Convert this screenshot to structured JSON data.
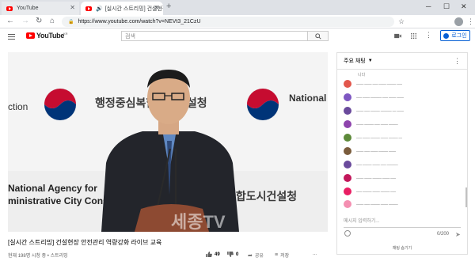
{
  "browser": {
    "tabs": [
      {
        "title": "YouTube",
        "active": false
      },
      {
        "title": "[실시간 스트리밍] 건설현장",
        "active": true
      }
    ],
    "url": "https://www.youtube.com/watch?v=NEVt3_21CzU",
    "new_tab_symbol": "+",
    "window_controls": [
      "─",
      "☐",
      "✕"
    ],
    "icons": [
      "back-icon",
      "forward-icon",
      "reload-icon",
      "home-icon",
      "lock-icon",
      "star-icon",
      "profile-icon",
      "menu-icon"
    ]
  },
  "youtube": {
    "logo_text": "YouTube",
    "logo_suffix": "KR",
    "search_placeholder": "검색",
    "login_label": "로그인",
    "colors": {
      "brand": "#ff0000",
      "link": "#065fd4"
    }
  },
  "video": {
    "title": "[실시간 스트리밍] 건설현장 안전관리 역량강화 라이브 교육",
    "meta": "현재 198명 시청 중 • 스트리밍",
    "likes": "49",
    "dislikes": "0",
    "share_label": "공유",
    "save_label": "저장",
    "more_label": "...",
    "frame": {
      "backdrop_center": "행정중심복합도시건설청",
      "backdrop_right": "National Administ",
      "backdrop_left": "ction",
      "backdrop_bottom_en_1": "National Agency for",
      "backdrop_bottom_en_2": "ministrative City Const",
      "backdrop_bottom_kr": "복합도시건설청",
      "watermark": "세종TV"
    }
  },
  "chat": {
    "title": "주요 채팅",
    "first_line": "니다",
    "messages": [
      {
        "avatar_color": "#e2574c",
        "text": "━━━━ ━━━━ ━━━ ━━━━ ━━━━━ ━━━"
      },
      {
        "avatar_color": "#7e57c2",
        "text": "━━━ ━━━━ ━━━━━━ ━━━ ━━━━ ━━━━"
      },
      {
        "avatar_color": "#6a4a9c",
        "text": "━━━━ ━━━ ━━━━━ ━━━━━━ ━━ ━━━━"
      },
      {
        "avatar_color": "#8e44ad",
        "text": "━━━━ ━━━━━ ━━━ ━━━━ ━━━━━"
      },
      {
        "avatar_color": "#5d8a3a",
        "text": "━━━ ━━━━ ━━━━━ ━━━━ ━━━━━ ━━"
      },
      {
        "avatar_color": "#7a5c3c",
        "text": "━━━━ ━━━ ━━━━ ━━━━━ ━━━━"
      },
      {
        "avatar_color": "#6a4a9c",
        "text": "━━━ ━━━━━ ━━━━ ━━━ ━━━━━━"
      },
      {
        "avatar_color": "#c2185b",
        "text": "━━━━ ━━━━ ━━━━━ ━━━━ ━━━"
      },
      {
        "avatar_color": "#e91e63",
        "text": "━━━ ━━━━━ ━━━━ ━━━━━ ━━━"
      },
      {
        "avatar_color": "#f48fb1",
        "text": "━━━━ ━━━ ━━━━━ ━━━━ ━━━━━"
      }
    ],
    "input_placeholder": "메시지 입력하기...",
    "counter": "0/200",
    "hide_label": "채팅 숨기기"
  }
}
